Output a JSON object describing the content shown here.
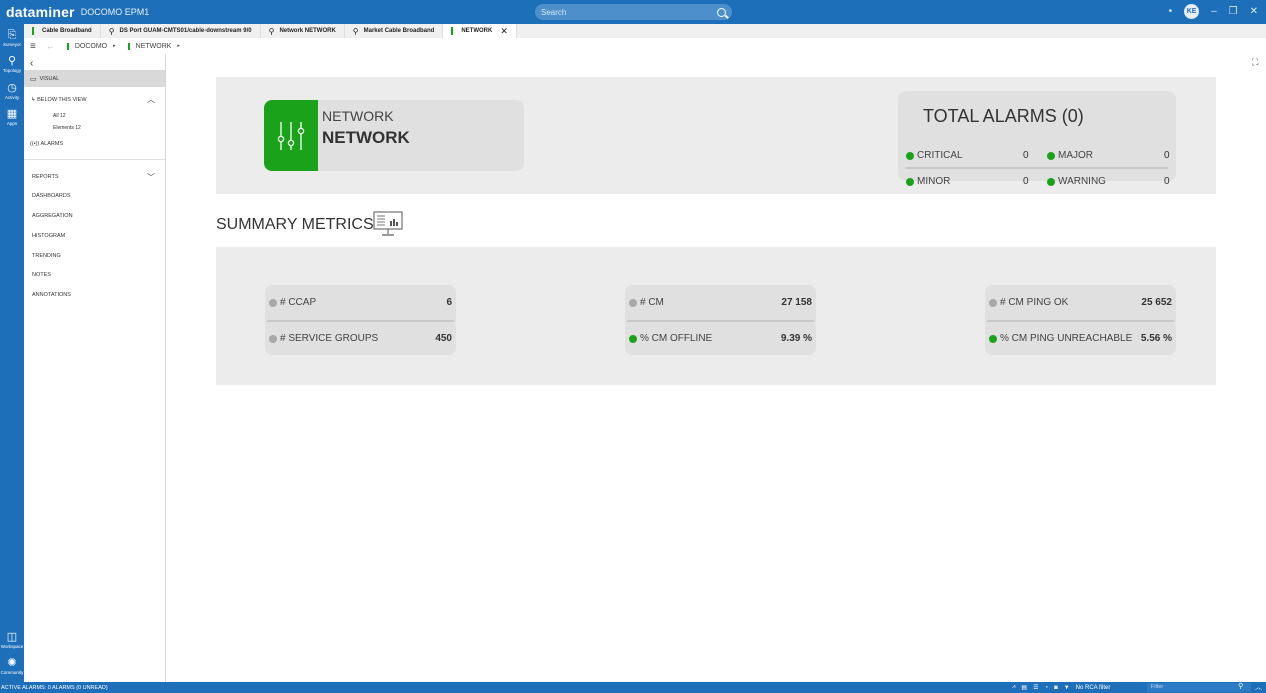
{
  "app": {
    "brand": "dataminer",
    "subtitle": "DOCOMO EPM1",
    "user_initials": "KE"
  },
  "search": {
    "placeholder": "Search"
  },
  "rail": [
    {
      "label": "Surveyor",
      "icon": "surveyor-icon"
    },
    {
      "label": "Topology",
      "icon": "topology-icon"
    },
    {
      "label": "Activity",
      "icon": "activity-icon"
    },
    {
      "label": "Apps",
      "icon": "apps-icon"
    },
    {
      "label": "Workspace",
      "icon": "workspace-icon"
    },
    {
      "label": "Community",
      "icon": "community-icon"
    }
  ],
  "tabs": [
    {
      "label": "Cable Broadband"
    },
    {
      "label": "DS Port GUAM-CMTS01/cable-downstream 9/0"
    },
    {
      "label": "Network NETWORK"
    },
    {
      "label": "Market Cable Broadband"
    },
    {
      "label": "NETWORK"
    }
  ],
  "breadcrumb": {
    "root": "DOCOMO",
    "current": "NETWORK"
  },
  "nav": {
    "visual": "VISUAL",
    "below": "BELOW THIS VIEW",
    "all": "All 12",
    "elements": "Elements 12",
    "alarms": "ALARMS",
    "reports": "REPORTS",
    "items": [
      "DASHBOARDS",
      "AGGREGATION",
      "HISTOGRAM",
      "TRENDING",
      "NOTES",
      "ANNOTATIONS"
    ]
  },
  "element": {
    "subtitle": "NETWORK",
    "title": "NETWORK",
    "color": "#1aa31a"
  },
  "alarms": {
    "title": "TOTAL ALARMS (0)",
    "critical_label": "CRITICAL",
    "critical": "0",
    "major_label": "MAJOR",
    "major": "0",
    "minor_label": "MINOR",
    "minor": "0",
    "warning_label": "WARNING",
    "warning": "0"
  },
  "summary": {
    "title": "SUMMARY METRICS"
  },
  "metrics": [
    {
      "top_label": "# CCAP",
      "top_value": "6",
      "top_status": "grey",
      "bottom_label": "# SERVICE GROUPS",
      "bottom_value": "450",
      "bottom_status": "grey"
    },
    {
      "top_label": "# CM",
      "top_value": "27 158",
      "top_status": "grey",
      "bottom_label": "% CM OFFLINE",
      "bottom_value": "9.39 %",
      "bottom_status": "green"
    },
    {
      "top_label": "# CM PING OK",
      "top_value": "25 652",
      "top_status": "grey",
      "bottom_label": "% CM PING UNREACHABLE",
      "bottom_value": "5.56 %",
      "bottom_status": "green"
    }
  ],
  "status": {
    "active_alarms": "ACTIVE ALARMS: 0 ALARMS (0 UNREAD)",
    "rca": "No RCA filter",
    "filter_placeholder": "Filter"
  },
  "colors": {
    "brand_blue": "#1e6fb9",
    "ok_green": "#1aa31a",
    "panel_grey": "#ececec"
  }
}
